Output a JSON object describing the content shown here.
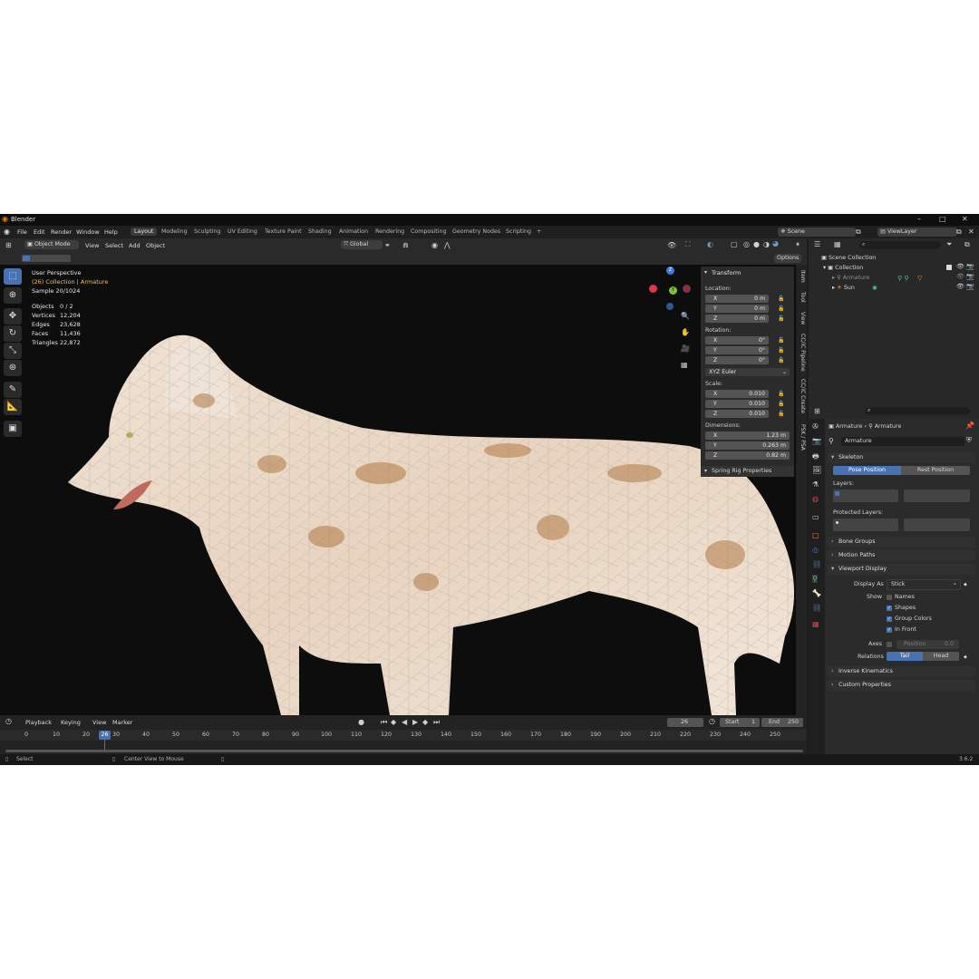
{
  "app": {
    "title": "Blender",
    "version": "3.6.2"
  },
  "menu": [
    "File",
    "Edit",
    "Render",
    "Window",
    "Help"
  ],
  "workspaces": [
    "Layout",
    "Modeling",
    "Sculpting",
    "UV Editing",
    "Texture Paint",
    "Shading",
    "Animation",
    "Rendering",
    "Compositing",
    "Geometry Nodes",
    "Scripting",
    "+"
  ],
  "scene": {
    "name": "Scene",
    "view_layer": "ViewLayer"
  },
  "header": {
    "mode": "Object Mode",
    "menu": [
      "View",
      "Select",
      "Add",
      "Object"
    ],
    "orientation": "Global",
    "options": "Options"
  },
  "viewport": {
    "perspective": "User Perspective",
    "collection_prefix": "(26) Collection | ",
    "active_object": "Armature",
    "sample": "Sample 20/1024",
    "stats": [
      {
        "label": "Objects",
        "value": "0 / 2"
      },
      {
        "label": "Vertices",
        "value": "12,204"
      },
      {
        "label": "Edges",
        "value": "23,628"
      },
      {
        "label": "Faces",
        "value": "11,436"
      },
      {
        "label": "Triangles",
        "value": "22,872"
      }
    ]
  },
  "npanel": {
    "title": "Transform",
    "location_label": "Location:",
    "location": [
      {
        "axis": "X",
        "value": "0 m"
      },
      {
        "axis": "Y",
        "value": "0 m"
      },
      {
        "axis": "Z",
        "value": "0 m"
      }
    ],
    "rotation_label": "Rotation:",
    "rotation": [
      {
        "axis": "X",
        "value": "0°"
      },
      {
        "axis": "Y",
        "value": "0°"
      },
      {
        "axis": "Z",
        "value": "0°"
      }
    ],
    "rotation_mode": "XYZ Euler",
    "scale_label": "Scale:",
    "scale": [
      {
        "axis": "X",
        "value": "0.010"
      },
      {
        "axis": "Y",
        "value": "0.010"
      },
      {
        "axis": "Z",
        "value": "0.010"
      }
    ],
    "dimensions_label": "Dimensions:",
    "dimensions": [
      {
        "axis": "X",
        "value": "1.23 m"
      },
      {
        "axis": "Y",
        "value": "0.263 m"
      },
      {
        "axis": "Z",
        "value": "0.82 m"
      }
    ],
    "spring_rig": "Spring Rig Properties"
  },
  "sidetabs": [
    "Item",
    "Tool",
    "View",
    "CC/iC Pipeline",
    "CC/iC Create",
    "PSK / PSA"
  ],
  "outliner": {
    "scene_collection": "Scene Collection",
    "collection": "Collection",
    "items": [
      "Armature",
      "Sun"
    ]
  },
  "properties": {
    "breadcrumb": [
      "Armature",
      "Armature"
    ],
    "data_name": "Armature",
    "skeleton": "Skeleton",
    "pose_position": "Pose Position",
    "rest_position": "Rest Position",
    "layers": "Layers:",
    "protected_layers": "Protected Layers:",
    "bone_groups": "Bone Groups",
    "motion_paths": "Motion Paths",
    "viewport_display": "Viewport Display",
    "display_as_label": "Display As",
    "display_as": "Stick",
    "show_label": "Show",
    "show": [
      {
        "label": "Names",
        "checked": false
      },
      {
        "label": "Shapes",
        "checked": true
      },
      {
        "label": "Group Colors",
        "checked": true
      },
      {
        "label": "In Front",
        "checked": true
      }
    ],
    "axes_label": "Axes",
    "axes_position": "Position",
    "axes_value": "0.0",
    "relations_label": "Relations",
    "tail": "Tail",
    "head": "Head",
    "inverse_kinematics": "Inverse Kinematics",
    "custom_properties": "Custom Properties"
  },
  "timeline": {
    "menu": [
      "Playback",
      "Keying",
      "View",
      "Marker"
    ],
    "current_frame": "26",
    "start_label": "Start",
    "start": "1",
    "end_label": "End",
    "end": "250",
    "ticks": [
      "0",
      "10",
      "20",
      "30",
      "40",
      "50",
      "60",
      "70",
      "80",
      "90",
      "100",
      "110",
      "120",
      "130",
      "140",
      "150",
      "160",
      "170",
      "180",
      "190",
      "200",
      "210",
      "220",
      "230",
      "240",
      "250"
    ]
  },
  "status": {
    "select": "Select",
    "center_view": "Center View to Mouse"
  },
  "colors": {
    "accent": "#4772b3",
    "active_object": "#e8c065",
    "viewport_bg": "#0d0d0d"
  }
}
